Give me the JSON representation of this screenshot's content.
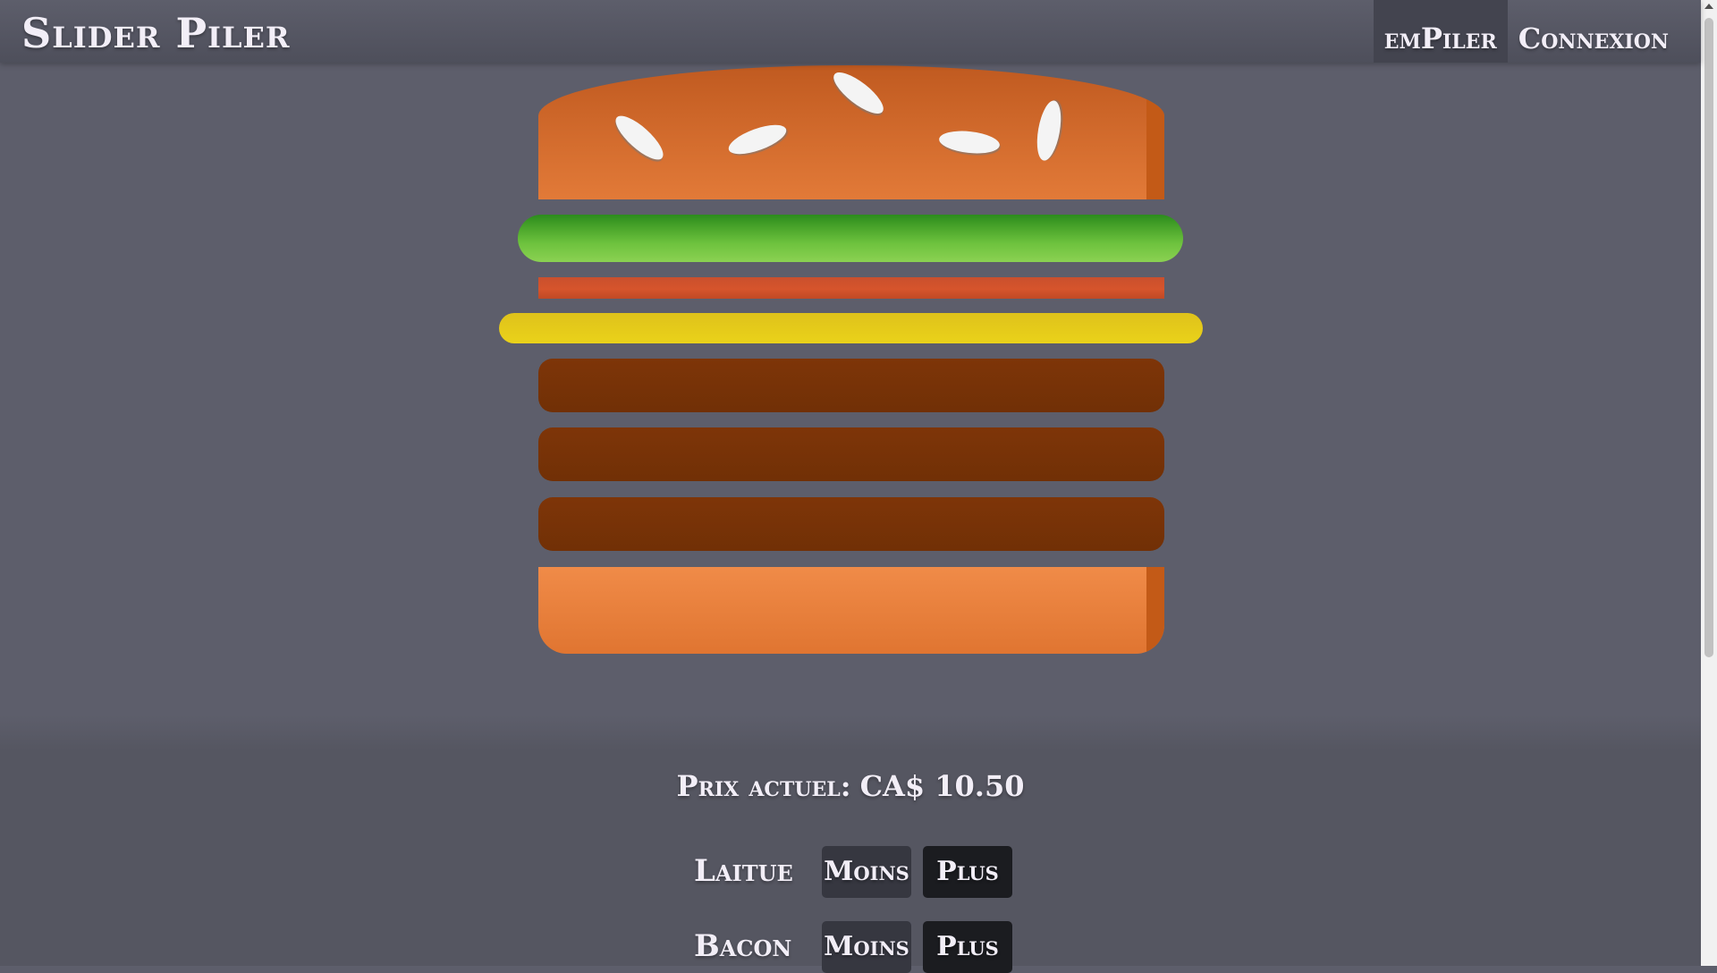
{
  "app": {
    "brand": "Slider Piler"
  },
  "nav": {
    "items": [
      {
        "label": "emPiler"
      },
      {
        "label": "Connexion"
      }
    ]
  },
  "burger": {
    "layers": [
      "bun-top",
      "lettuce",
      "tomato",
      "cheese",
      "patty",
      "patty",
      "patty",
      "bun-bottom"
    ],
    "colors": {
      "bun": "#e27a38",
      "lettuce": "#6dc23d",
      "tomato": "#d6542c",
      "cheese": "#ead21a",
      "patty": "#7a3407",
      "seed": "#f4f4f4"
    }
  },
  "price": {
    "label": "Prix actuel:",
    "value": "CA$ 10.50"
  },
  "ingredients": [
    {
      "name": "Laitue",
      "minus": "Moins",
      "plus": "Plus"
    },
    {
      "name": "Bacon",
      "minus": "Moins",
      "plus": "Plus"
    }
  ],
  "colors": {
    "background": "#5d5e6b",
    "panel": "#555661",
    "nav_active": "#43444f",
    "button_minus": "#363740",
    "button_plus": "#1b1c20",
    "text": "#f2eef7"
  }
}
